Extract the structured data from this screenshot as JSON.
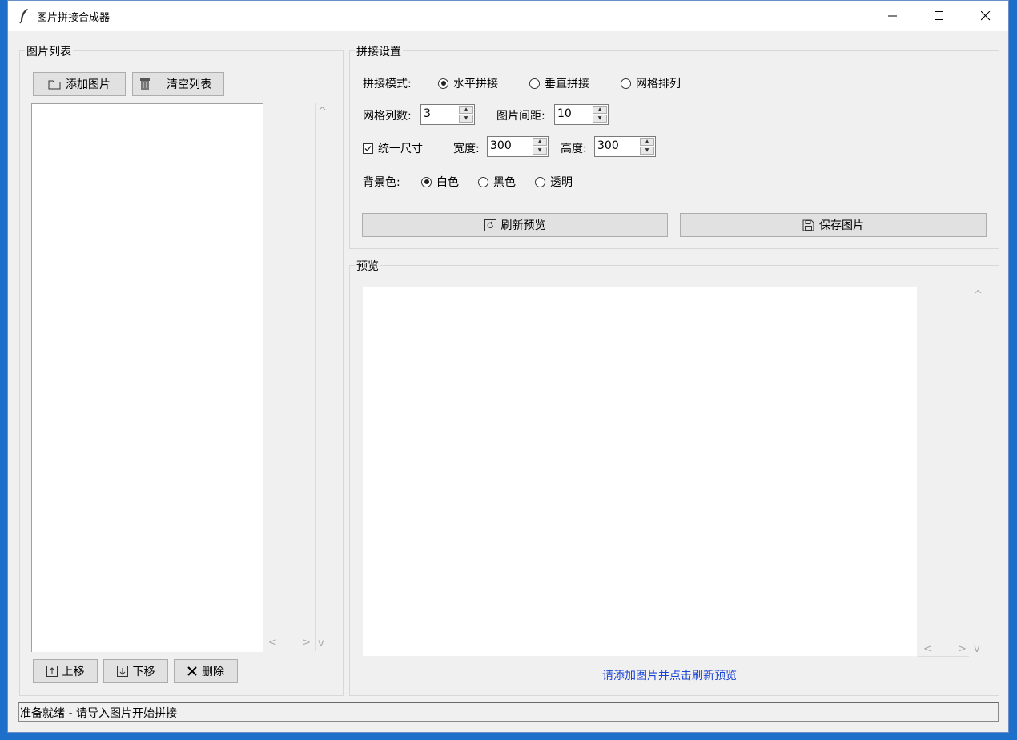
{
  "window": {
    "title": "图片拼接合成器",
    "icon": "feather-icon"
  },
  "list_panel": {
    "label": "图片列表",
    "add_button": "添加图片",
    "clear_button": "清空列表",
    "up_button": "上移",
    "down_button": "下移",
    "delete_button": "删除"
  },
  "settings": {
    "label": "拼接设置",
    "mode_label": "拼接模式:",
    "modes": [
      "水平拼接",
      "垂直拼接",
      "网格排列"
    ],
    "selected_mode": "水平拼接",
    "grid_cols_label": "网格列数:",
    "grid_cols_value": "3",
    "spacing_label": "图片间距:",
    "spacing_value": "10",
    "uniform_label": "统一尺寸",
    "uniform_checked": true,
    "width_label": "宽度:",
    "width_value": "300",
    "height_label": "高度:",
    "height_value": "300",
    "bg_label": "背景色:",
    "bg_options": [
      "白色",
      "黑色",
      "透明"
    ],
    "selected_bg": "白色",
    "refresh_button": "刷新预览",
    "save_button": "保存图片"
  },
  "preview": {
    "label": "预览",
    "hint": "请添加图片并点击刷新预览"
  },
  "status": {
    "text": "准备就绪 - 请导入图片开始拼接"
  },
  "colors": {
    "hint_text": "#1a44d6",
    "window_bg": "#f0f0f0",
    "desktop": "#1e6fc9"
  }
}
